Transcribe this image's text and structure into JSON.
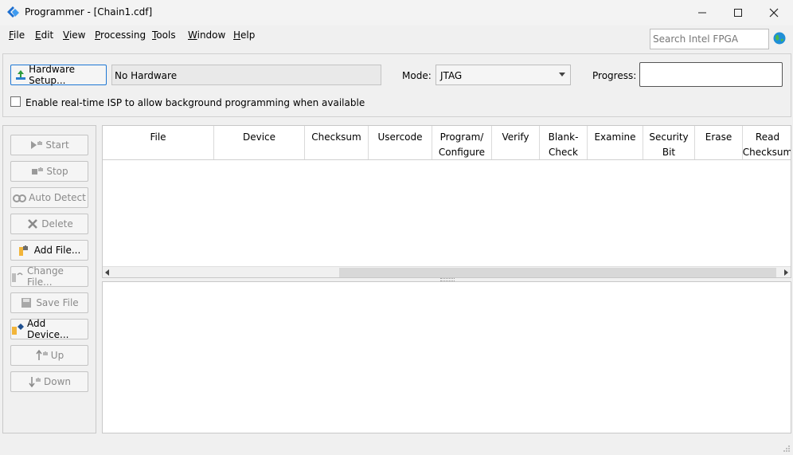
{
  "window": {
    "title": "Programmer - [Chain1.cdf]",
    "controls": {
      "minimize": "—",
      "maximize": "☐",
      "close": "✕"
    }
  },
  "menu": [
    {
      "key": "F",
      "rest": "ile"
    },
    {
      "key": "E",
      "rest": "dit"
    },
    {
      "key": "V",
      "rest": "iew"
    },
    {
      "key": "P",
      "rest": "rocessing"
    },
    {
      "key": "T",
      "rest": "ools"
    },
    {
      "key": "W",
      "rest": "indow"
    },
    {
      "key": "H",
      "rest": "elp"
    }
  ],
  "search": {
    "placeholder": "Search Intel FPGA"
  },
  "hardware": {
    "setup_label": "Hardware Setup...",
    "current": "No Hardware",
    "mode_label": "Mode:",
    "mode_value": "JTAG",
    "progress_label": "Progress:",
    "progress_value": 0,
    "isp_label": "Enable real-time ISP to allow background programming when available",
    "isp_checked": false
  },
  "sidebar": {
    "buttons": [
      {
        "label": "Start",
        "icon": "start-icon",
        "enabled": false
      },
      {
        "label": "Stop",
        "icon": "stop-icon",
        "enabled": false
      },
      {
        "label": "Auto Detect",
        "icon": "auto-detect-icon",
        "enabled": false
      },
      {
        "label": "Delete",
        "icon": "delete-icon",
        "enabled": false
      },
      {
        "label": "Add File...",
        "icon": "add-file-icon",
        "enabled": true
      },
      {
        "label": "Change File...",
        "icon": "change-file-icon",
        "enabled": false
      },
      {
        "label": "Save File",
        "icon": "save-file-icon",
        "enabled": false
      },
      {
        "label": "Add Device...",
        "icon": "add-device-icon",
        "enabled": true
      },
      {
        "label": "Up",
        "icon": "up-icon",
        "enabled": false
      },
      {
        "label": "Down",
        "icon": "down-icon",
        "enabled": false
      }
    ]
  },
  "table": {
    "columns": [
      {
        "l1": "File",
        "l2": ""
      },
      {
        "l1": "Device",
        "l2": ""
      },
      {
        "l1": "Checksum",
        "l2": ""
      },
      {
        "l1": "Usercode",
        "l2": ""
      },
      {
        "l1": "Program/",
        "l2": "Configure"
      },
      {
        "l1": "Verify",
        "l2": ""
      },
      {
        "l1": "Blank-",
        "l2": "Check"
      },
      {
        "l1": "Examine",
        "l2": ""
      },
      {
        "l1": "Security",
        "l2": "Bit"
      },
      {
        "l1": "Erase",
        "l2": ""
      },
      {
        "l1": "Read",
        "l2": "Checksum"
      }
    ],
    "rows": []
  },
  "colors": {
    "accent": "#1e77d4",
    "disabled_text": "#8a8a8a"
  }
}
